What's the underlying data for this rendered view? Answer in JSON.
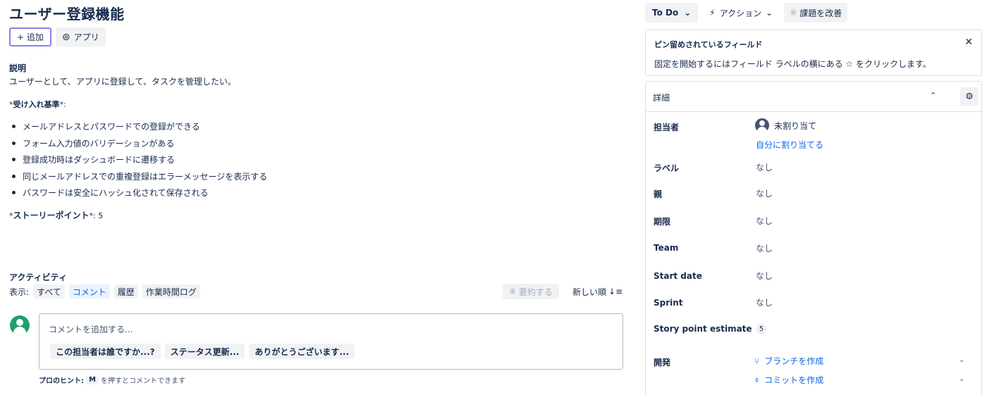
{
  "issue": {
    "title": "ユーザー登録機能",
    "add_button": "+ 追加",
    "apps_button": "アプリ",
    "description_heading": "説明",
    "description_text": "ユーザーとして、アプリに登録して、タスクを管理したい。",
    "ac_prefix": "*",
    "ac_heading": "受け入れ基準",
    "ac_suffix": "*:",
    "criteria": [
      "メールアドレスとパスワードでの登録ができる",
      "フォーム入力値のバリデーションがある",
      "登録成功時はダッシュボードに遷移する",
      "同じメールアドレスでの重複登録はエラーメッセージを表示する",
      "パスワードは安全にハッシュ化されて保存される"
    ],
    "sp_prefix": "*",
    "sp_heading": "ストーリーポイント",
    "sp_suffix": "*: 5"
  },
  "activity": {
    "heading": "アクティビティ",
    "show_label": "表示:",
    "filters": [
      "すべて",
      "コメント",
      "履歴",
      "作業時間ログ"
    ],
    "active_filter": "コメント",
    "summarize": "要約する",
    "sort": "新しい順",
    "comment_placeholder": "コメントを追加する...",
    "quick_replies": [
      "この担当者は誰ですか...?",
      "ステータス更新...",
      "ありがとうございます..."
    ],
    "hint_label": "プロのヒント:",
    "hint_key": "M",
    "hint_text": "を押すとコメントできます"
  },
  "toolbar": {
    "status": "To Do",
    "actions": "アクション",
    "improve": "課題を改善"
  },
  "pinned": {
    "heading": "ピン留めされているフィールド",
    "text": "固定を開始するにはフィールド ラベルの横にある ☆ をクリックします。"
  },
  "details": {
    "heading": "詳細",
    "assignee_label": "担当者",
    "assignee_value": "未割り当て",
    "assign_to_me": "自分に割り当てる",
    "fields": [
      {
        "label": "ラベル",
        "value": "なし"
      },
      {
        "label": "親",
        "value": "なし"
      },
      {
        "label": "期限",
        "value": "なし"
      },
      {
        "label": "Team",
        "value": "なし"
      },
      {
        "label": "Start date",
        "value": "なし"
      },
      {
        "label": "Sprint",
        "value": "なし"
      }
    ],
    "story_point_label": "Story point estimate",
    "story_point_value": "5",
    "dev_label": "開発",
    "create_branch": "ブランチを作成",
    "create_commit": "コミットを作成"
  },
  "colors": {
    "link": "#0c66e4",
    "avatar": "#22a06b",
    "add_border": "#8f7ee7"
  }
}
